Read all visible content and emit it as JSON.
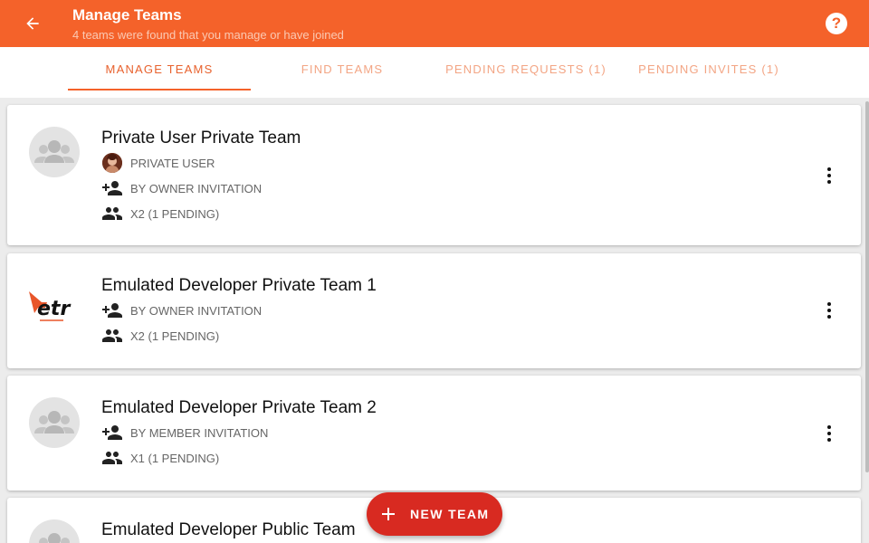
{
  "appbar": {
    "title": "Manage Teams",
    "subtitle": "4 teams were found that you manage or have joined",
    "back_icon": "arrow-back-icon",
    "help_icon": "help-circle-icon",
    "help_glyph": "?"
  },
  "tabs": [
    {
      "label": "MANAGE TEAMS",
      "active": true
    },
    {
      "label": "FIND TEAMS",
      "active": false
    },
    {
      "label": "PENDING REQUESTS (1)",
      "active": false
    },
    {
      "label": "PENDING INVITES (1)",
      "active": false
    }
  ],
  "teams": [
    {
      "name": "Private User Private Team",
      "owner": "PRIVATE USER",
      "join_type": "BY OWNER INVITATION",
      "members": "X2 (1 PENDING)",
      "avatar": "group-placeholder-icon"
    },
    {
      "name": "Emulated Developer Private Team 1",
      "join_type": "BY OWNER INVITATION",
      "members": "X2 (1 PENDING)",
      "avatar": "team-logo"
    },
    {
      "name": "Emulated Developer Private Team 2",
      "join_type": "BY MEMBER INVITATION",
      "members": "X1 (1 PENDING)",
      "avatar": "group-placeholder-icon"
    },
    {
      "name": "Emulated Developer Public Team",
      "avatar": "group-placeholder-icon"
    }
  ],
  "fab": {
    "label": "NEW TEAM",
    "icon": "plus-icon"
  },
  "colors": {
    "primary": "#f4622a",
    "fab": "#d82a21",
    "background": "#ececec"
  }
}
